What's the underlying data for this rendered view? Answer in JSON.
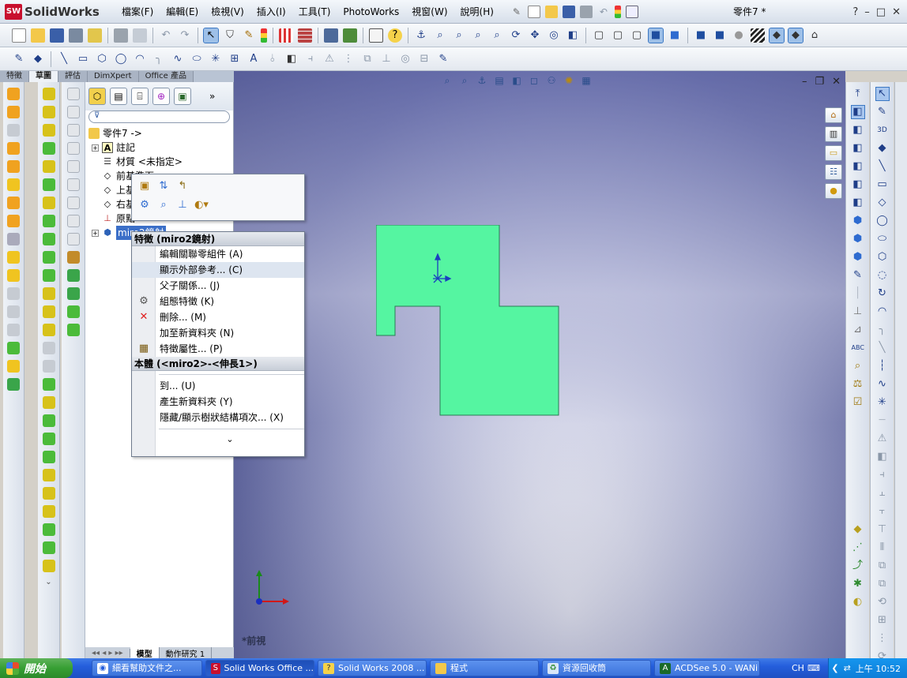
{
  "app": {
    "logo_text": "SolidWorks",
    "logo_badge": "SW",
    "document_title": "零件7 *"
  },
  "menus": [
    {
      "label": "檔案(F)"
    },
    {
      "label": "編輯(E)"
    },
    {
      "label": "檢視(V)"
    },
    {
      "label": "插入(I)"
    },
    {
      "label": "工具(T)"
    },
    {
      "label": "PhotoWorks"
    },
    {
      "label": "視窗(W)"
    },
    {
      "label": "說明(H)"
    }
  ],
  "window_controls": {
    "help": "?",
    "minimize": "–",
    "maximize": "□",
    "close": "✕"
  },
  "tabs": [
    {
      "label": "特徵"
    },
    {
      "label": "草圖"
    },
    {
      "label": "評估"
    },
    {
      "label": "DimXpert"
    },
    {
      "label": "Office 產品"
    }
  ],
  "feature_manager": {
    "filter_icon": "funnel-icon",
    "tree": [
      {
        "label": "零件7 ->"
      },
      {
        "label": "註記"
      },
      {
        "label": "材質 <未指定>"
      },
      {
        "label": "前基準面"
      },
      {
        "label": "上基準面"
      },
      {
        "label": "右基準面"
      },
      {
        "label": "原點"
      },
      {
        "label": "miro2鏡射"
      }
    ],
    "bottom_tabs": [
      {
        "label": "模型"
      },
      {
        "label": "動作研究 1"
      }
    ]
  },
  "context_menu": {
    "feature_header": "特徵 (miro2鏡射)",
    "feature_items": [
      {
        "label": "編輯關聯零組件 (A)"
      },
      {
        "label": "顯示外部參考... (C)"
      },
      {
        "label": "父子關係... (J)"
      },
      {
        "label": "組態特徵 (K)"
      },
      {
        "label": "刪除... (M)"
      },
      {
        "label": "加至新資料夾 (N)"
      },
      {
        "label": "特徵屬性... (P)"
      }
    ],
    "body_header": "本體 (<miro2>-<伸長1>)",
    "tree_items": [
      {
        "label": "到... (U)"
      },
      {
        "label": "產生新資料夾 (Y)"
      },
      {
        "label": "隱藏/顯示樹狀結構項次... (X)"
      }
    ],
    "more": "⌄"
  },
  "viewport": {
    "view_label": "*前視",
    "controls": {
      "minimize": "–",
      "restore": "❐",
      "close": "✕"
    }
  },
  "colors": {
    "sketch_fill": "#55f5a1",
    "sketch_stroke": "#2a7c55",
    "accent": "#3c78c3"
  },
  "taskbar": {
    "start_label": "開始",
    "items": [
      {
        "label": "細看幫助文件之..."
      },
      {
        "label": "Solid Works Office ..."
      },
      {
        "label": "Solid Works 2008 ..."
      },
      {
        "label": "程式"
      },
      {
        "label": "資源回收筒"
      },
      {
        "label": "ACDSee 5.0 - WANi"
      }
    ],
    "lang": "CH",
    "clock": "上午 10:52"
  }
}
